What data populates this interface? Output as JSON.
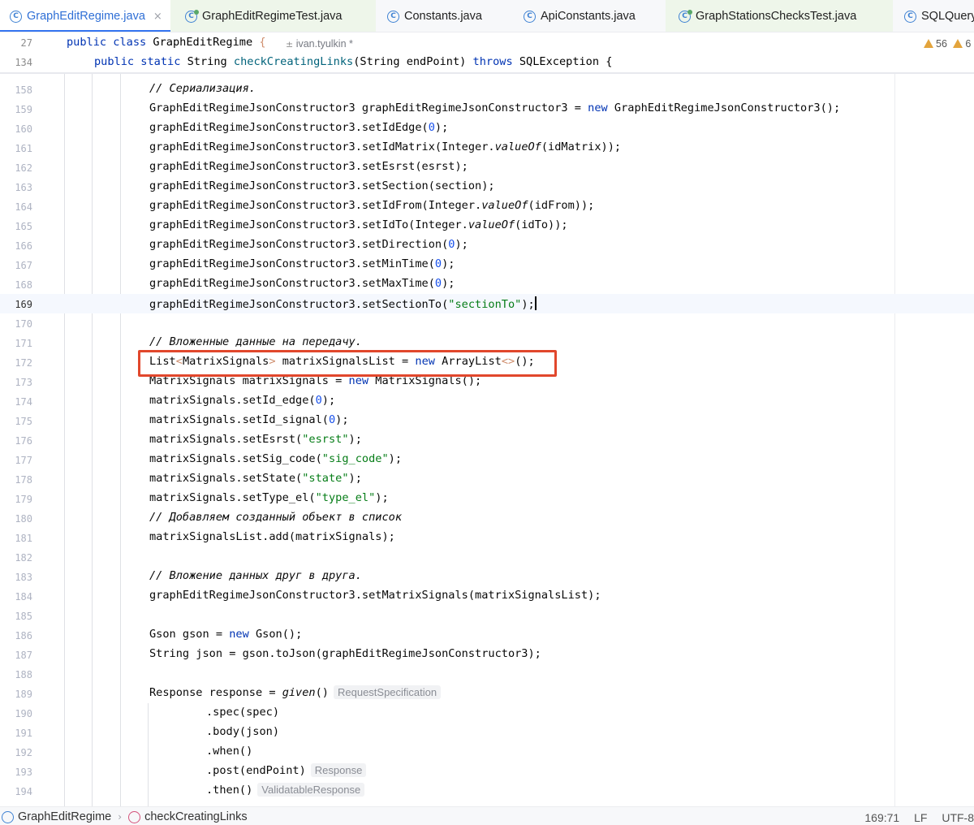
{
  "tabs": [
    {
      "label": "GraphEditRegime.java",
      "icon": "class-icon",
      "active": true
    },
    {
      "label": "GraphEditRegimeTest.java",
      "icon": "test-class-icon"
    },
    {
      "label": "Constants.java",
      "icon": "class-icon"
    },
    {
      "label": "ApiConstants.java",
      "icon": "class-icon"
    },
    {
      "label": "GraphStationsChecksTest.java",
      "icon": "test-class-icon"
    },
    {
      "label": "SQLQuery",
      "icon": "class-icon"
    }
  ],
  "tab_close_glyph": "×",
  "sticky": {
    "line1": {
      "number": "27",
      "kw": "public class",
      "name": "GraphEditRegime",
      "brace": "{"
    },
    "author": "ivan.tyulkin *",
    "warnings": "56",
    "warnings2": "6",
    "line2": {
      "number": "134",
      "kw1": "public static",
      "type": "String",
      "method": "checkCreatingLinks",
      "params": "(String endPoint)",
      "kw2": "throws",
      "exc": "SQLException {"
    }
  },
  "lines": [
    {
      "n": "158"
    },
    {
      "n": "159"
    },
    {
      "n": "160"
    },
    {
      "n": "161"
    },
    {
      "n": "162"
    },
    {
      "n": "163"
    },
    {
      "n": "164"
    },
    {
      "n": "165"
    },
    {
      "n": "166"
    },
    {
      "n": "167"
    },
    {
      "n": "168"
    },
    {
      "n": "169"
    },
    {
      "n": "170"
    },
    {
      "n": "171"
    },
    {
      "n": "172"
    },
    {
      "n": "173"
    },
    {
      "n": "174"
    },
    {
      "n": "175"
    },
    {
      "n": "176"
    },
    {
      "n": "177"
    },
    {
      "n": "178"
    },
    {
      "n": "179"
    },
    {
      "n": "180"
    },
    {
      "n": "181"
    },
    {
      "n": "182"
    },
    {
      "n": "183"
    },
    {
      "n": "184"
    },
    {
      "n": "185"
    },
    {
      "n": "186"
    },
    {
      "n": "187"
    },
    {
      "n": "188"
    },
    {
      "n": "189"
    },
    {
      "n": "190"
    },
    {
      "n": "191"
    },
    {
      "n": "192"
    },
    {
      "n": "193"
    },
    {
      "n": "194"
    }
  ],
  "code": {
    "c158": "// Сериализация.",
    "c159a": "GraphEditRegimeJsonConstructor3 graphEditRegimeJsonConstructor3 = ",
    "c159kw": "new",
    "c159b": " GraphEditRegimeJsonConstructor3();",
    "c160a": "graphEditRegimeJsonConstructor3.setIdEdge(",
    "c160n": "0",
    "c160b": ");",
    "c161a": "graphEditRegimeJsonConstructor3.setIdMatrix(Integer.",
    "c161i": "valueOf",
    "c161b": "(idMatrix));",
    "c162": "graphEditRegimeJsonConstructor3.setEsrst(esrst);",
    "c163": "graphEditRegimeJsonConstructor3.setSection(section);",
    "c164a": "graphEditRegimeJsonConstructor3.setIdFrom(Integer.",
    "c164i": "valueOf",
    "c164b": "(idFrom));",
    "c165a": "graphEditRegimeJsonConstructor3.setIdTo(Integer.",
    "c165i": "valueOf",
    "c165b": "(idTo));",
    "c166a": "graphEditRegimeJsonConstructor3.setDirection(",
    "c166n": "0",
    "c166b": ");",
    "c167a": "graphEditRegimeJsonConstructor3.setMinTime(",
    "c167n": "0",
    "c167b": ");",
    "c168a": "graphEditRegimeJsonConstructor3.setMaxTime(",
    "c168n": "0",
    "c168b": ");",
    "c169a": "graphEditRegimeJsonConstructor3.setSectionTo(",
    "c169s": "\"sectionTo\"",
    "c169b": ");",
    "c171": "// Вложенные данные на передачу.",
    "c172a": "List",
    "c172g1": "<",
    "c172t": "MatrixSignals",
    "c172g2": ">",
    "c172b": " matrixSignalsList = ",
    "c172kw": "new",
    "c172c": " ArrayList",
    "c172g3": "<>",
    "c172d": "();",
    "c173a": "MatrixSignals matrixSignals = ",
    "c173kw": "new",
    "c173b": " MatrixSignals();",
    "c174a": "matrixSignals.setId_edge(",
    "c174n": "0",
    "c174b": ");",
    "c175a": "matrixSignals.setId_signal(",
    "c175n": "0",
    "c175b": ");",
    "c176a": "matrixSignals.setEsrst(",
    "c176s": "\"esrst\"",
    "c176b": ");",
    "c177a": "matrixSignals.setSig_code(",
    "c177s": "\"sig_code\"",
    "c177b": ");",
    "c178a": "matrixSignals.setState(",
    "c178s": "\"state\"",
    "c178b": ");",
    "c179a": "matrixSignals.setType_el(",
    "c179s": "\"type_el\"",
    "c179b": ");",
    "c180": "// Добавляем созданный объект в список",
    "c181": "matrixSignalsList.add(matrixSignals);",
    "c183": "// Вложение данных друг в друга.",
    "c184": "graphEditRegimeJsonConstructor3.setMatrixSignals(matrixSignalsList);",
    "c186a": "Gson gson = ",
    "c186kw": "new",
    "c186b": " Gson();",
    "c187": "String json = gson.toJson(graphEditRegimeJsonConstructor3);",
    "c189a": "Response response = ",
    "c189i": "given",
    "c189b": "()",
    "c189h": "RequestSpecification",
    "c190": ".spec(spec)",
    "c191": ".body(json)",
    "c192": ".when()",
    "c193a": ".post(endPoint)",
    "c193h": "Response",
    "c194a": ".then()",
    "c194h": "ValidatableResponse"
  },
  "statusbar": {
    "crumb1": "GraphEditRegime",
    "crumb2": "checkCreatingLinks",
    "separator": "›",
    "position": "169:71",
    "line_sep": "LF",
    "encoding": "UTF-8"
  },
  "colors": {
    "keyword": "#0033b3",
    "string": "#067d17",
    "number": "#1750eb",
    "comment": "#8c8c8c",
    "highlight_box": "#e1472c",
    "active_tab": "#3574f0"
  }
}
